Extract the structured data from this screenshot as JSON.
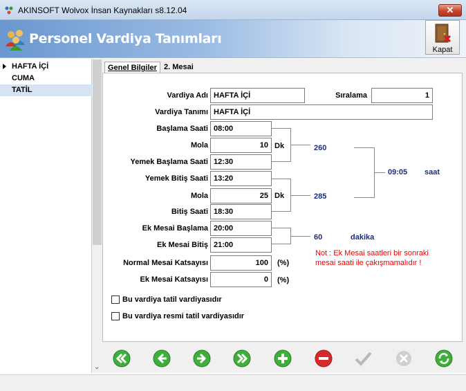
{
  "window": {
    "title": "AKINSOFT Wolvox İnsan Kaynakları s8.12.04",
    "close": "✕"
  },
  "header": {
    "title": "Personel Vardiya Tanımları",
    "kapat": "Kapat"
  },
  "list": [
    {
      "label": "HAFTA İÇİ",
      "selected": true
    },
    {
      "label": "CUMA",
      "selected": false
    },
    {
      "label": "TATİL",
      "selected": false
    }
  ],
  "tabs": {
    "genel": "Genel Bilgiler",
    "mesai": "2. Mesai"
  },
  "form": {
    "vardiya_adi_label": "Vardiya Adı",
    "vardiya_adi": "HAFTA İÇİ",
    "siralama_label": "Sıralama",
    "siralama": "1",
    "vardiya_tanimi_label": "Vardiya Tanımı",
    "vardiya_tanimi": "HAFTA İÇİ",
    "baslama_saati_label": "Başlama Saati",
    "baslama_saati": "08:00",
    "mola1_label": "Mola",
    "mola1": "10",
    "mola1_unit": "Dk",
    "yemek_baslama_label": "Yemek Başlama Saati",
    "yemek_baslama": "12:30",
    "yemek_bitis_label": "Yemek Bitiş Saati",
    "yemek_bitis": "13:20",
    "mola2_label": "Mola",
    "mola2": "25",
    "mola2_unit": "Dk",
    "bitis_saati_label": "Bitiş Saati",
    "bitis_saati": "18:30",
    "ek_baslama_label": "Ek Mesai Başlama",
    "ek_baslama": "20:00",
    "ek_bitis_label": "Ek Mesai Bitiş",
    "ek_bitis": "21:00",
    "normal_katsayi_label": "Normal Mesai Katsayısı",
    "normal_katsayi": "100",
    "ek_katsayi_label": "Ek Mesai Katsayısı",
    "ek_katsayi": "0",
    "percent": "(%)",
    "total1": "260",
    "total2": "285",
    "total_time": "09:05",
    "total_time_unit": "saat",
    "ek_total": "60",
    "ek_total_unit": "dakika",
    "note_line1": "Not : Ek Mesai saatleri bir sonraki",
    "note_line2": "mesai saati ile çakışmamalıdır !",
    "chk_tatil_label": "Bu vardiya tatil vardiyasıdır",
    "chk_resmi_label": "Bu vardiya resmi tatil vardiyasıdır"
  },
  "colors": {
    "nav_green": "#3fae3a",
    "nav_red": "#d42a2a",
    "nav_gray": "#b8b8b8"
  },
  "icons": {
    "first": "double-left-arrow-icon",
    "prev": "left-arrow-icon",
    "next": "right-arrow-icon",
    "last": "double-right-arrow-icon",
    "add": "plus-icon",
    "delete": "minus-icon",
    "save": "check-icon",
    "cancel": "x-icon",
    "refresh": "refresh-icon"
  }
}
